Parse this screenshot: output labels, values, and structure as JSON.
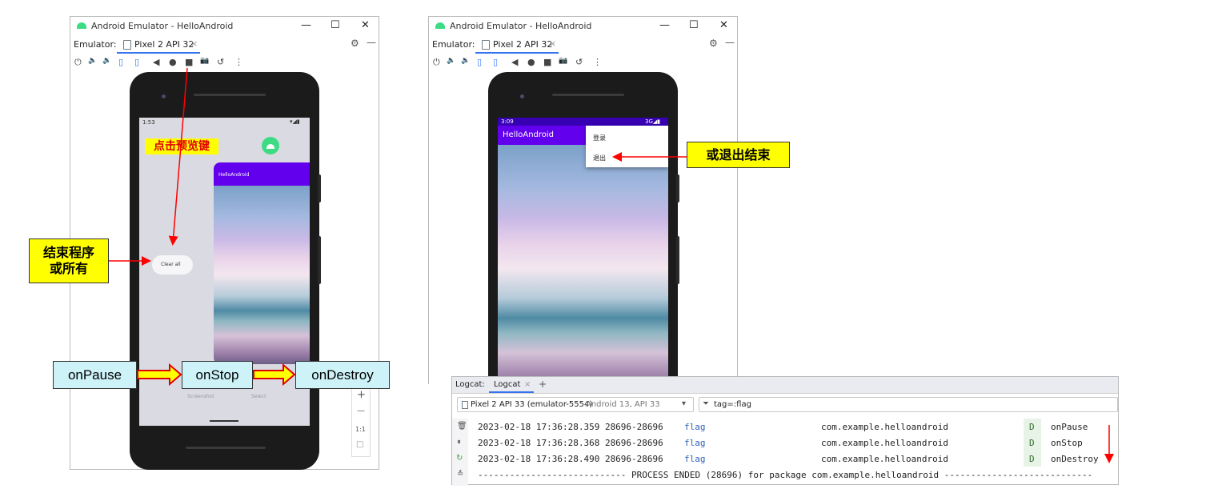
{
  "left_window": {
    "title": "Android Emulator - HelloAndroid",
    "emulator_label": "Emulator:",
    "device_tab": "Pixel 2 API 32",
    "tab_close": "×",
    "win_min": "—",
    "win_max": "☐",
    "win_close": "✕",
    "settings": "⚙",
    "collapse": "—",
    "toolbar_icons": [
      "⏻",
      "🔈",
      "🔉",
      "▯",
      "▯",
      "◀",
      "●",
      "■",
      "📷",
      "↺",
      "⋮"
    ],
    "phone": {
      "status_time": "1:53",
      "status_right": "▾◢▮",
      "app_card_title": "HelloAndroid",
      "clear_all": "Clear all",
      "screenshot": "Screenshot",
      "select": "Select"
    },
    "side_controls": [
      "+",
      "—",
      "1:1",
      "□"
    ]
  },
  "right_window": {
    "title": "Android Emulator - HelloAndroid",
    "emulator_label": "Emulator:",
    "device_tab": "Pixel 2 API 32",
    "tab_close": "×",
    "win_min": "—",
    "win_max": "☐",
    "win_close": "✕",
    "settings": "⚙",
    "collapse": "—",
    "phone": {
      "status_time": "3:09",
      "status_right": "3G◢▮",
      "app_title": "HelloAndroid",
      "menu": [
        "登录",
        "退出"
      ]
    }
  },
  "annotations": {
    "click_overview": "点击预览键",
    "end_program_line1": "结束程序",
    "end_program_line2": "或所有",
    "or_exit": "或退出结束",
    "on_pause": "onPause",
    "on_stop": "onStop",
    "on_destroy": "onDestroy"
  },
  "logcat": {
    "label": "Logcat:",
    "tab": "Logcat",
    "tab_close": "×",
    "add": "+",
    "device": "Pixel 2 API 33 (emulator-5554)",
    "device_detail": "Android 13, API 33",
    "filter": "tag=:flag",
    "rows": [
      {
        "time": "2023-02-18 17:36:28.359 28696-28696",
        "tag": "flag",
        "pkg": "com.example.helloandroid",
        "level": "D",
        "msg": "onPause"
      },
      {
        "time": "2023-02-18 17:36:28.368 28696-28696",
        "tag": "flag",
        "pkg": "com.example.helloandroid",
        "level": "D",
        "msg": "onStop"
      },
      {
        "time": "2023-02-18 17:36:28.490 28696-28696",
        "tag": "flag",
        "pkg": "com.example.helloandroid",
        "level": "D",
        "msg": "onDestroy"
      }
    ],
    "process_ended": "---------------------------- PROCESS ENDED (28696) for package com.example.helloandroid ----------------------------"
  },
  "colors": {
    "annotation_yellow": "#ffff00",
    "annotation_cyan": "#cdf2f8",
    "arrow_red": "#ff0000",
    "app_bar_purple": "#6200ee",
    "tab_underline": "#3574f0"
  }
}
